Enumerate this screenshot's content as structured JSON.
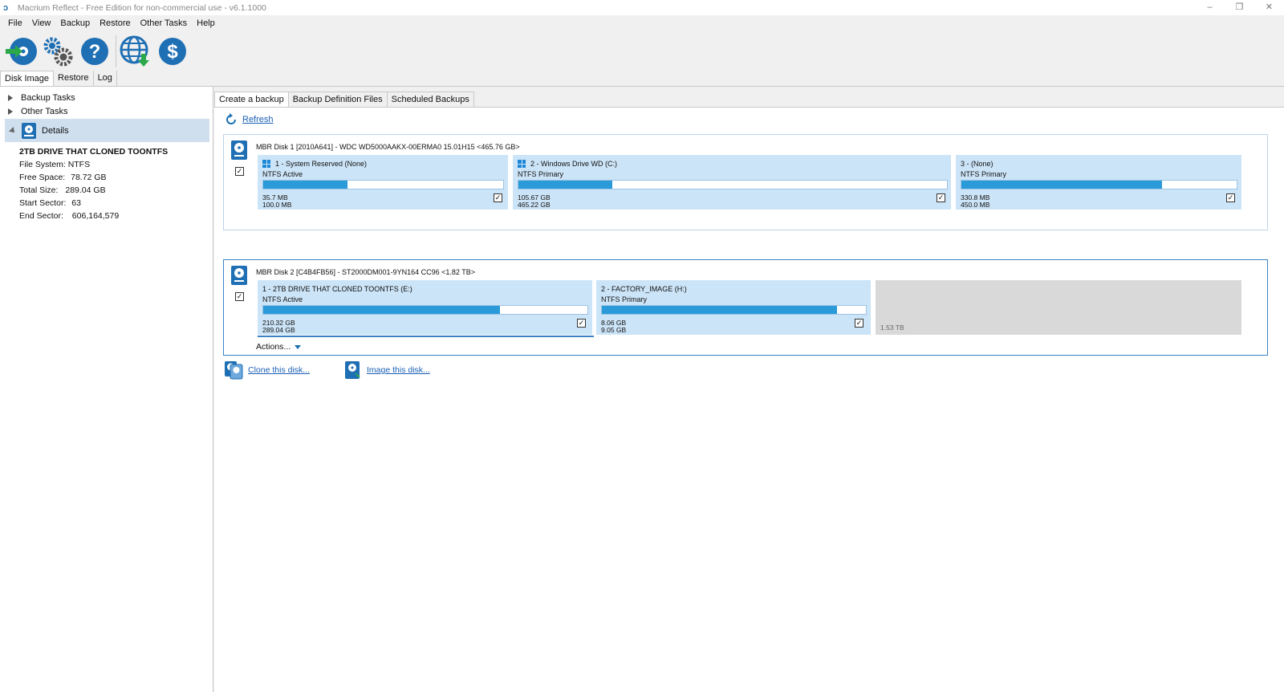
{
  "window": {
    "title": "Macrium Reflect - Free Edition for non-commercial use - v6.1.1000",
    "minimize": "–",
    "restore": "❐",
    "close": "✕"
  },
  "menu": [
    "File",
    "View",
    "Backup",
    "Restore",
    "Other Tasks",
    "Help"
  ],
  "left_tabs": [
    "Disk Image",
    "Restore",
    "Log"
  ],
  "left_tree": {
    "backup_tasks": "Backup Tasks",
    "other_tasks": "Other Tasks",
    "details": "Details"
  },
  "details": {
    "title": "2TB DRIVE THAT CLONED TOONTFS",
    "file_system_label": "File System:",
    "file_system": "NTFS",
    "free_space_label": "Free Space:",
    "free_space": "78.72 GB",
    "total_size_label": "Total Size:",
    "total_size": "289.04 GB",
    "start_sector_label": "Start Sector:",
    "start_sector": "63",
    "end_sector_label": "End Sector:",
    "end_sector": "606,164,579"
  },
  "right_tabs": [
    "Create a backup",
    "Backup Definition Files",
    "Scheduled Backups"
  ],
  "refresh_label": "Refresh",
  "disk1": {
    "title": "MBR Disk 1 [2010A641] - WDC WD5000AAKX-00ERMA0 15.01H15  <465.76 GB>",
    "partitions": [
      {
        "name": "1 - System Reserved (None)",
        "type": "NTFS Active",
        "used": "35.7 MB",
        "total": "100.0 MB",
        "fill": 0.35
      },
      {
        "name": "2 - Windows Drive WD (C:)",
        "type": "NTFS Primary",
        "used": "105.67 GB",
        "total": "465.22 GB",
        "fill": 0.22
      },
      {
        "name": "3 -  (None)",
        "type": "NTFS Primary",
        "used": "330.8 MB",
        "total": "450.0 MB",
        "fill": 0.73
      }
    ]
  },
  "disk2": {
    "title": "MBR Disk 2 [C4B4FB56] - ST2000DM001-9YN164 CC96  <1.82 TB>",
    "partitions": [
      {
        "name": "1 - 2TB DRIVE THAT CLONED TOONTFS (E:)",
        "type": "NTFS Active",
        "used": "210.32 GB",
        "total": "289.04 GB",
        "fill": 0.73
      },
      {
        "name": "2 - FACTORY_IMAGE (H:)",
        "type": "NTFS Primary",
        "used": "8.06 GB",
        "total": "9.05 GB",
        "fill": 0.89
      }
    ],
    "unallocated": "1.53 TB",
    "actions": "Actions..."
  },
  "clone_label": "Clone this disk...",
  "image_label": "Image this disk...",
  "check_mark": "✓"
}
